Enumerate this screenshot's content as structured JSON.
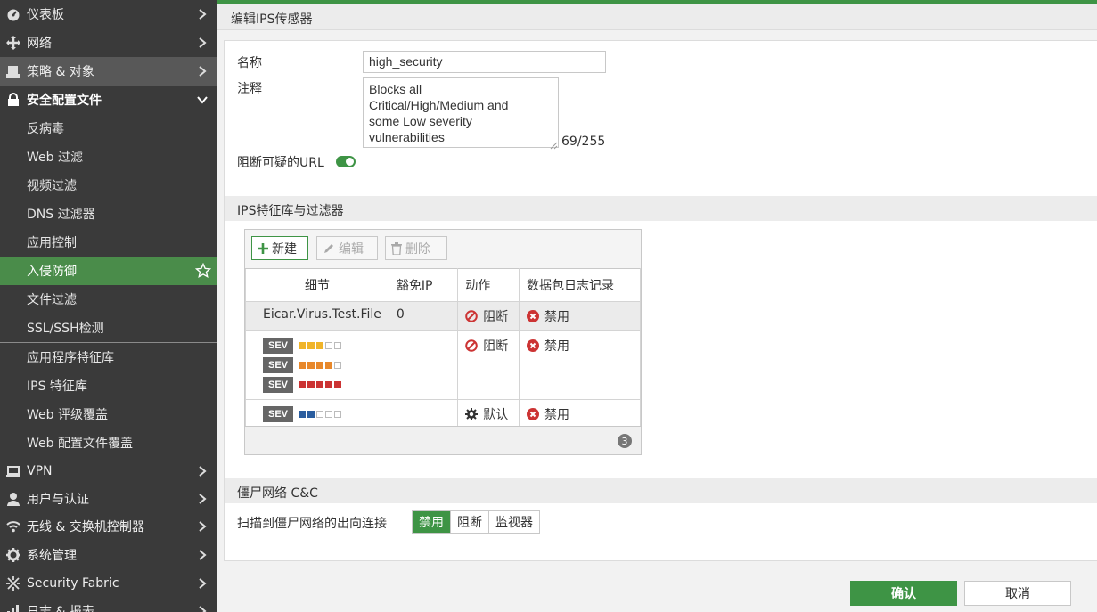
{
  "sidebar": {
    "top_items": [
      {
        "label": "仪表板",
        "icon": "dashboard-icon"
      },
      {
        "label": "网络",
        "icon": "network-icon"
      },
      {
        "label": "策略 & 对象",
        "icon": "policy-icon"
      },
      {
        "label": "安全配置文件",
        "icon": "lock-icon"
      }
    ],
    "sub_items": [
      "反病毒",
      "Web 过滤",
      "视频过滤",
      "DNS 过滤器",
      "应用控制",
      "入侵防御",
      "文件过滤",
      "SSL/SSH检测"
    ],
    "sub_items_2": [
      "应用程序特征库",
      "IPS 特征库",
      "Web 评级覆盖",
      "Web 配置文件覆盖"
    ],
    "bottom_items": [
      {
        "label": "VPN",
        "icon": "laptop-icon"
      },
      {
        "label": "用户与认证",
        "icon": "user-icon"
      },
      {
        "label": "无线 & 交换机控制器",
        "icon": "wifi-icon"
      },
      {
        "label": "系统管理",
        "icon": "gear-icon"
      },
      {
        "label": "Security Fabric",
        "icon": "fabric-icon"
      },
      {
        "label": "日志 & 报表",
        "icon": "chart-icon"
      }
    ]
  },
  "header": {
    "title": "编辑IPS传感器"
  },
  "form": {
    "name_label": "名称",
    "name_value": "high_security",
    "comment_label": "注释",
    "comment_value": "Blocks all\nCritical/High/Medium and\nsome Low severity\nvulnerabilities",
    "char_count": "69/255",
    "block_url_label": "阻断可疑的URL"
  },
  "ips_section": {
    "title": "IPS特征库与过滤器",
    "toolbar": {
      "new": "新建",
      "edit": "编辑",
      "delete": "删除"
    },
    "columns": [
      "细节",
      "豁免IP",
      "动作",
      "数据包日志记录"
    ],
    "rows": [
      {
        "detail": "Eicar.Virus.Test.File",
        "exempt_ip": "0",
        "action": "阻断",
        "log": "禁用"
      },
      {
        "sev": [
          "SEV",
          "SEV",
          "SEV"
        ],
        "action": "阻断",
        "log": "禁用"
      },
      {
        "sev": [
          "SEV"
        ],
        "action": "默认",
        "log": "禁用"
      }
    ],
    "count": "3"
  },
  "botnet_section": {
    "title": "僵尸网络 C&C",
    "scan_label": "扫描到僵尸网络的出向连接",
    "options": [
      "禁用",
      "阻断",
      "监视器"
    ],
    "selected": "禁用"
  },
  "buttons": {
    "ok": "确认",
    "cancel": "取消"
  },
  "colors": {
    "accent": "#3e9445",
    "sidebar_bg": "#3a3a3a",
    "block_red": "#cc3333",
    "sev_low_blue": "#2a5d9f",
    "sev_med_yellow": "#f0b429",
    "sev_high_orange": "#e8882a",
    "sev_crit_red": "#cc3333"
  }
}
